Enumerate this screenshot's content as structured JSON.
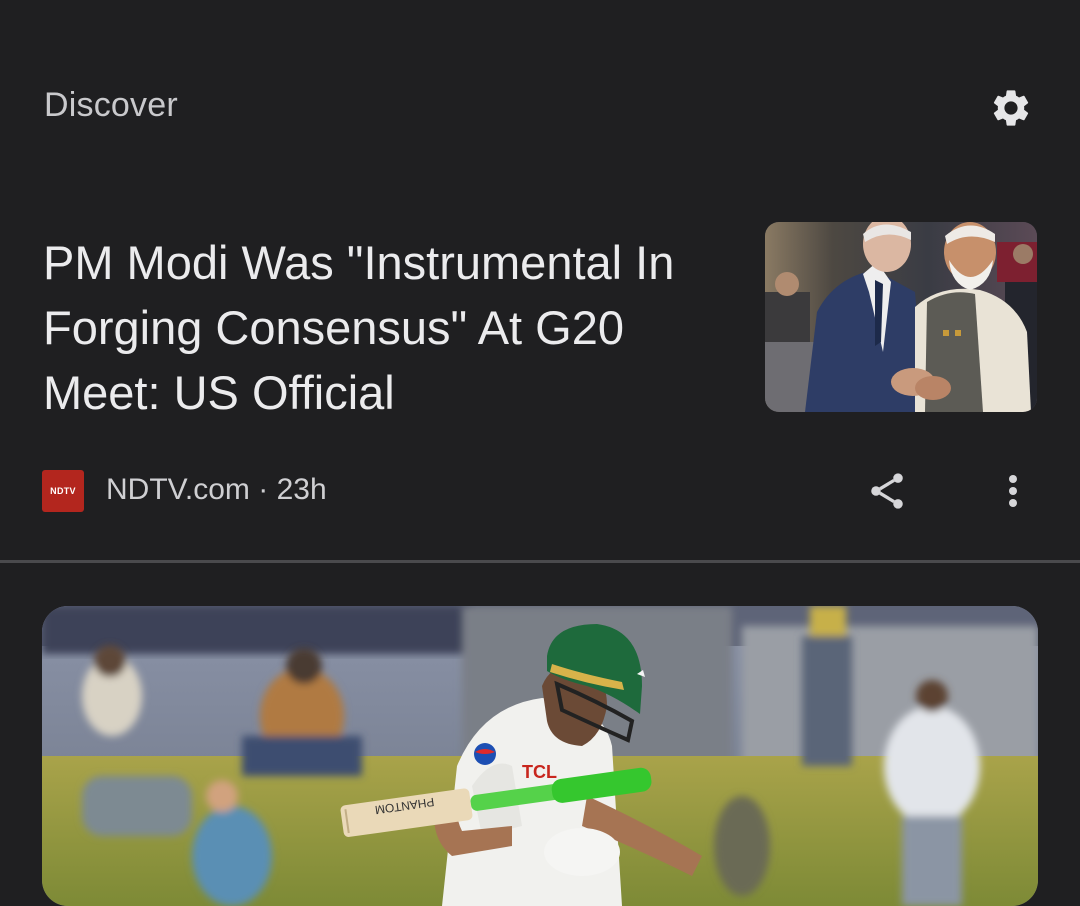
{
  "header": {
    "title": "Discover",
    "settings_icon": "gear-icon"
  },
  "feed": [
    {
      "headline": "PM Modi Was \"Instrumental In Forging Consensus\" At G20 Meet: US Official",
      "source_logo_text": "NDTV",
      "source_name": "NDTV.com",
      "separator": "·",
      "age": "23h",
      "share_icon": "share-icon",
      "more_icon": "more-vertical-icon"
    },
    {
      "image_text": {
        "bat_brand": "PHANTOM",
        "shirt_sponsor": "TCL"
      }
    }
  ],
  "colors": {
    "background": "#1f1f21",
    "divider": "#4a4a4d",
    "ndtv_red": "#b3261e",
    "text_primary": "#ebebed",
    "text_secondary": "#c9c9cc"
  }
}
